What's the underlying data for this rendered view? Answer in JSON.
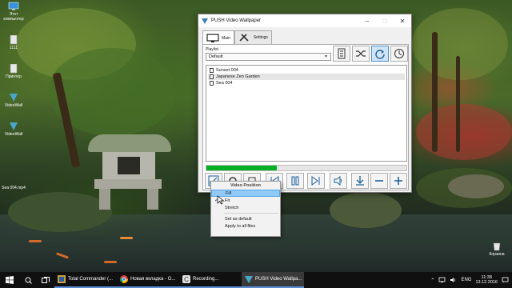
{
  "desktop": {
    "icons": [
      {
        "label": "Этот компьютер"
      },
      {
        "label": "1111"
      },
      {
        "label": "Принтер"
      },
      {
        "label": "VideoWall"
      },
      {
        "label": "VideoWall"
      },
      {
        "label": "Sea 004.mp4"
      }
    ],
    "recycle_bin_label": "Корзина"
  },
  "window": {
    "title": "PUSH Video Wallpaper",
    "tabs": [
      {
        "label": "Main"
      },
      {
        "label": "Settings"
      }
    ],
    "playlist_label": "Playlist",
    "playlist_value": "Default",
    "files": [
      "Sunset 004",
      "Japanese Zen Garden",
      "Sea 004"
    ],
    "selected_file_index": 1,
    "progress": 0.35
  },
  "context_menu": {
    "header": "Video Position",
    "items": [
      "Fill",
      "Fit",
      "Stretch"
    ],
    "checked": "Fit",
    "extra_items": [
      "Set as default",
      "Apply to all files"
    ]
  },
  "taskbar": {
    "tasks": [
      {
        "label": "Total Commander (..."
      },
      {
        "label": "Новая вкладка - G..."
      },
      {
        "label": "Recording..."
      },
      {
        "label": "PUSH Video Wallpa..."
      }
    ],
    "language": "ENG",
    "time": "11:38",
    "date": "13.12.2016"
  },
  "colors": {
    "accent_blue": "#3a7fc1",
    "progress_green": "#06b025",
    "menu_highlight": "#91c9f7"
  }
}
